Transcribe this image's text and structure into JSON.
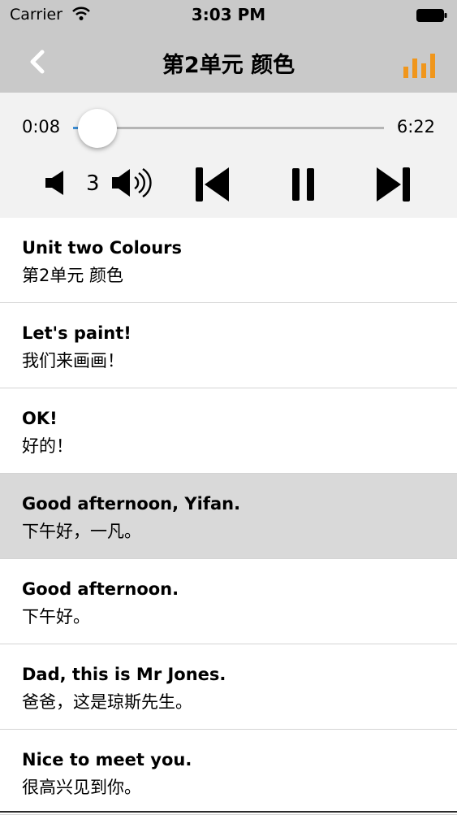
{
  "status_bar": {
    "carrier": "Carrier",
    "time": "3:03 PM",
    "battery_icon": "battery-full-icon",
    "wifi_icon": "wifi-icon"
  },
  "nav": {
    "title": "第2单元 颜色",
    "back_icon": "chevron-left-icon",
    "eq_icon": "equalizer-icon",
    "eq_color": "#f0961c"
  },
  "player": {
    "current_time": "0:08",
    "total_time": "6:22",
    "progress": 0.021,
    "volume": "3",
    "accent": "#3d8fd6"
  },
  "lines": [
    {
      "en": "Unit two Colours",
      "zh": "第2单元 颜色",
      "highlighted": false
    },
    {
      "en": "Let's paint!",
      "zh": "我们来画画！",
      "highlighted": false
    },
    {
      "en": "OK!",
      "zh": "好的！",
      "highlighted": false
    },
    {
      "en": "Good afternoon, Yifan.",
      "zh": "下午好，一凡。",
      "highlighted": true
    },
    {
      "en": "Good afternoon.",
      "zh": "下午好。",
      "highlighted": false
    },
    {
      "en": "Dad, this is Mr Jones.",
      "zh": "爸爸，这是琼斯先生。",
      "highlighted": false
    },
    {
      "en": "Nice to meet you.",
      "zh": "很高兴见到你。",
      "highlighted": false
    }
  ]
}
